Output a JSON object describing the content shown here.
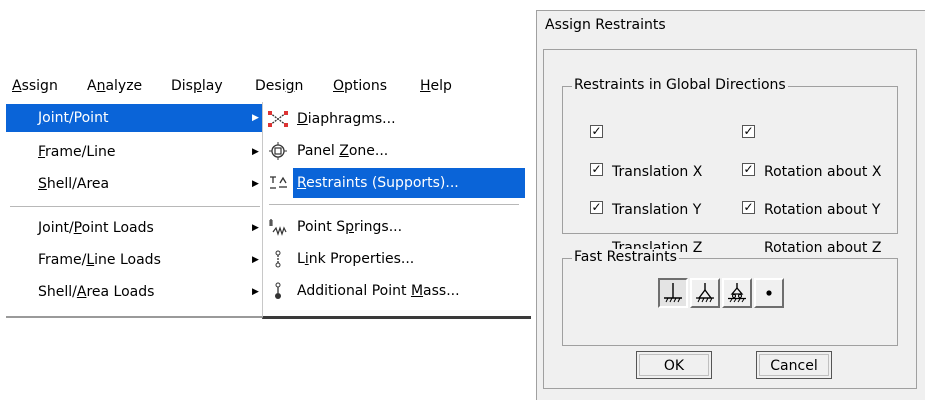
{
  "menubar": {
    "items": [
      {
        "label": "Assign",
        "mnemonic": "A"
      },
      {
        "label": "Analyze",
        "mnemonic": "n"
      },
      {
        "label": "Display",
        "mnemonic": "p"
      },
      {
        "label": "Design",
        "mnemonic": "g"
      },
      {
        "label": "Options",
        "mnemonic": "O"
      },
      {
        "label": "Help",
        "mnemonic": "H"
      }
    ]
  },
  "assign_menu": {
    "items": [
      {
        "label": "Joint/Point",
        "selected": true
      },
      {
        "label": "Frame/Line"
      },
      {
        "label": "Shell/Area"
      },
      {
        "label": "Joint/Point Loads"
      },
      {
        "label": "Frame/Line Loads"
      },
      {
        "label": "Shell/Area Loads"
      }
    ]
  },
  "joint_submenu": {
    "items": [
      {
        "label": "Diaphragms...",
        "icon": "diaphragm-icon"
      },
      {
        "label": "Panel Zone...",
        "icon": "panel-zone-icon"
      },
      {
        "label": "Restraints (Supports)...",
        "icon": "restraints-icon",
        "selected": true
      },
      {
        "label": "Point Springs...",
        "icon": "spring-icon"
      },
      {
        "label": "Link Properties...",
        "icon": "link-icon"
      },
      {
        "label": "Additional Point Mass...",
        "icon": "mass-icon"
      }
    ]
  },
  "dialog": {
    "title": "Assign Restraints",
    "global_group": {
      "legend": "Restraints in Global Directions",
      "checks": [
        {
          "label": "Translation X",
          "checked": true
        },
        {
          "label": "Rotation about X",
          "checked": true
        },
        {
          "label": "Translation Y",
          "checked": true
        },
        {
          "label": "Rotation about Y",
          "checked": true
        },
        {
          "label": "Translation Z",
          "checked": true
        },
        {
          "label": "Rotation about Z",
          "checked": true
        }
      ]
    },
    "fast_group": {
      "legend": "Fast Restraints",
      "buttons": [
        "fixed-support-icon",
        "pinned-support-icon",
        "roller-support-icon",
        "free-point-icon"
      ]
    },
    "ok_label": "OK",
    "cancel_label": "Cancel"
  },
  "colors": {
    "highlight": "#0a64d8",
    "dialog_bg": "#f0f0f0"
  }
}
